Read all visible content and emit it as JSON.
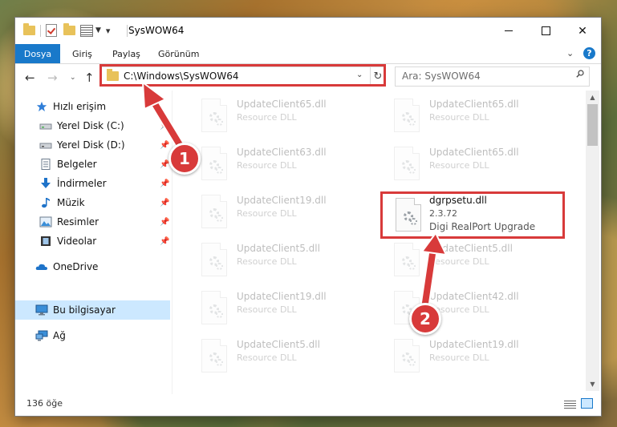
{
  "window": {
    "title": "SysWOW64",
    "controls": {
      "minimize": "",
      "maximize": "",
      "close": "✕"
    }
  },
  "ribbon": {
    "file_tab": "Dosya",
    "tabs": [
      "Giriş",
      "Paylaş",
      "Görünüm"
    ],
    "help": "?"
  },
  "navigation": {
    "back": "←",
    "forward": "→",
    "recent": "⌄",
    "up": "↑",
    "address": "C:\\Windows\\SysWOW64",
    "refresh": "↻",
    "search_placeholder": "Ara: SysWOW64"
  },
  "sidebar": {
    "items": [
      {
        "label": "Hızlı erişim",
        "icon": "star-icon",
        "pinned": false
      },
      {
        "label": "Yerel Disk (C:)",
        "icon": "drive-icon",
        "pinned": true
      },
      {
        "label": "Yerel Disk (D:)",
        "icon": "drive-icon",
        "pinned": true
      },
      {
        "label": "Belgeler",
        "icon": "documents-icon",
        "pinned": true
      },
      {
        "label": "İndirmeler",
        "icon": "download-icon",
        "pinned": true
      },
      {
        "label": "Müzik",
        "icon": "music-icon",
        "pinned": true
      },
      {
        "label": "Resimler",
        "icon": "pictures-icon",
        "pinned": true
      },
      {
        "label": "Videolar",
        "icon": "videos-icon",
        "pinned": true
      },
      {
        "label": "OneDrive",
        "icon": "cloud-icon",
        "pinned": false
      },
      {
        "label": "Bu bilgisayar",
        "icon": "computer-icon",
        "pinned": false,
        "selected": true
      },
      {
        "label": "Ağ",
        "icon": "network-icon",
        "pinned": false
      }
    ]
  },
  "files": [
    {
      "name": "UpdateClient65.dll",
      "desc": "Resource DLL"
    },
    {
      "name": "UpdateClient65.dll",
      "desc": "Resource DLL"
    },
    {
      "name": "UpdateClient63.dll",
      "desc": "Resource DLL"
    },
    {
      "name": "UpdateClient65.dll",
      "desc": "Resource DLL"
    },
    {
      "name": "UpdateClient19.dll",
      "desc": "Resource DLL"
    },
    {
      "name": "dgrpsetu.dll",
      "version": "2.3.72",
      "desc": "Digi RealPort Upgrade",
      "highlighted": true
    },
    {
      "name": "UpdateClient5.dll",
      "desc": "Resource DLL"
    },
    {
      "name": "UpdateClient5.dll",
      "desc": "Resource DLL"
    },
    {
      "name": "UpdateClient19.dll",
      "desc": "Resource DLL"
    },
    {
      "name": "UpdateClient42.dll",
      "desc": "Resource DLL"
    },
    {
      "name": "UpdateClient5.dll",
      "desc": "Resource DLL"
    },
    {
      "name": "UpdateClient19.dll",
      "desc": "Resource DLL"
    }
  ],
  "status": {
    "count": "136 öğe"
  },
  "annotations": {
    "step1": "1",
    "step2": "2",
    "color": "#d83a3a"
  }
}
